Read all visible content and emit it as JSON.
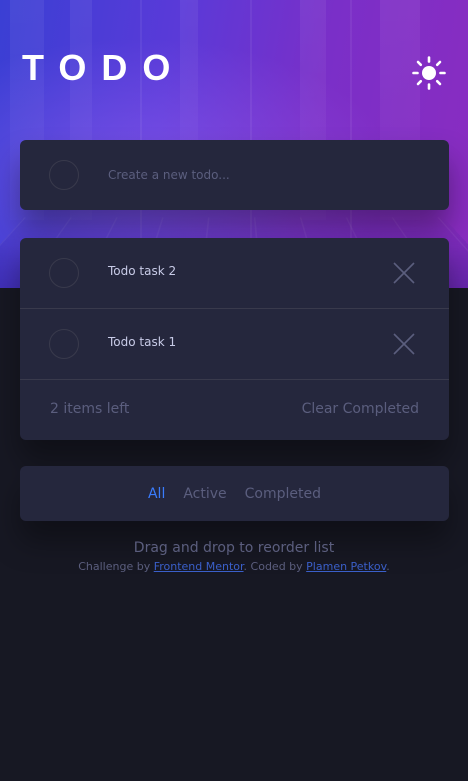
{
  "header": {
    "title": "TODO",
    "theme_toggle_icon": "sun-icon"
  },
  "create": {
    "placeholder": "Create a new todo..."
  },
  "todos": [
    {
      "text": "Todo task 2",
      "completed": false
    },
    {
      "text": "Todo task 1",
      "completed": false
    }
  ],
  "footer": {
    "items_left": "2 items left",
    "clear_label": "Clear Completed"
  },
  "filters": {
    "all": "All",
    "active": "Active",
    "completed": "Completed",
    "selected": "All"
  },
  "hint": "Drag and drop to reorder list",
  "attribution": {
    "prefix": "Challenge by ",
    "mentor_link": "Frontend Mentor",
    "middle": ". Coded by ",
    "author_link": "Plamen Petkov",
    "suffix": "."
  },
  "colors": {
    "background": "#171823",
    "card": "#25273d",
    "accent": "#3a7cfd",
    "text": "#c8cbe7",
    "muted": "#5b5e7e",
    "border": "#393a4c"
  }
}
